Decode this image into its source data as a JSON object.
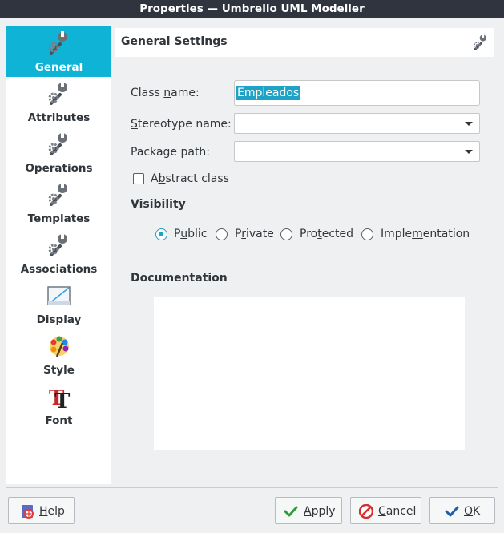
{
  "window": {
    "title": "Properties — Umbrello UML Modeller"
  },
  "sidebar": {
    "items": [
      {
        "label": "General",
        "icon": "wrench-gear-icon",
        "active": true
      },
      {
        "label": "Attributes",
        "icon": "wrench-gear-icon"
      },
      {
        "label": "Operations",
        "icon": "wrench-gear-icon"
      },
      {
        "label": "Templates",
        "icon": "wrench-gear-icon"
      },
      {
        "label": "Associations",
        "icon": "wrench-gear-icon"
      },
      {
        "label": "Display",
        "icon": "display-icon"
      },
      {
        "label": "Style",
        "icon": "style-palette-icon"
      },
      {
        "label": "Font",
        "icon": "font-icon"
      }
    ]
  },
  "header": {
    "title": "General Settings",
    "icon": "wrench-gear-icon"
  },
  "form": {
    "class_name_label": "Class name:",
    "class_name_value": "Empleados",
    "stereotype_label": "Stereotype name:",
    "stereotype_value": "",
    "package_label": "Package path:",
    "package_value": "",
    "abstract_label": "Abstract class",
    "abstract_checked": false
  },
  "visibility": {
    "title": "Visibility",
    "options": [
      {
        "label": "Public",
        "checked": true
      },
      {
        "label": "Private",
        "checked": false
      },
      {
        "label": "Protected",
        "checked": false
      },
      {
        "label": "Implementation",
        "checked": false
      }
    ]
  },
  "documentation": {
    "title": "Documentation",
    "value": ""
  },
  "buttons": {
    "help": "Help",
    "apply": "Apply",
    "cancel": "Cancel",
    "ok": "OK"
  },
  "colors": {
    "accent": "#0fb3d6",
    "selection": "#1ea2c5",
    "titlebar": "#2f343f"
  }
}
